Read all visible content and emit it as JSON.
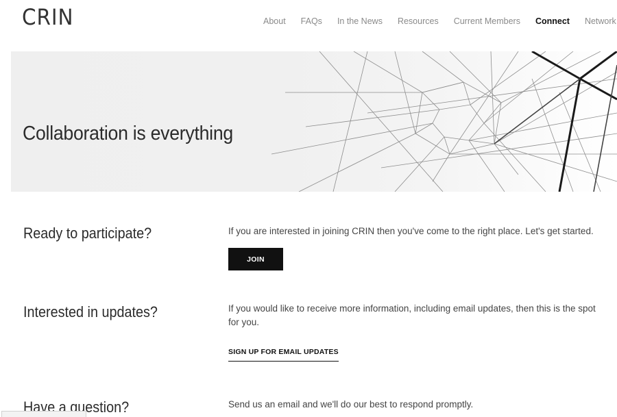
{
  "header": {
    "logo": "CRIN",
    "nav": [
      {
        "label": "About",
        "active": false
      },
      {
        "label": "FAQs",
        "active": false
      },
      {
        "label": "In the News",
        "active": false
      },
      {
        "label": "Resources",
        "active": false
      },
      {
        "label": "Current Members",
        "active": false
      },
      {
        "label": "Connect",
        "active": true
      },
      {
        "label": "Network Event",
        "active": false
      }
    ]
  },
  "hero": {
    "title": "Collaboration is everything"
  },
  "sections": {
    "participate": {
      "heading": "Ready to participate?",
      "text": "If you are interested in joining CRIN then you've come to the right place. Let's get started.",
      "button": "JOIN"
    },
    "updates": {
      "heading": "Interested in updates?",
      "text": "If you would like to receive more information, including email updates, then this is the spot for you.",
      "link": "SIGN UP FOR EMAIL UPDATES"
    },
    "question": {
      "heading": "Have a question?",
      "text": "Send us an email and we'll do our best to respond promptly."
    }
  },
  "colors": {
    "text_dark": "#2b2b2b",
    "nav_inactive": "#8a8a8a",
    "nav_active": "#111111",
    "button_bg": "#111111",
    "hero_bg": "#efefef"
  }
}
